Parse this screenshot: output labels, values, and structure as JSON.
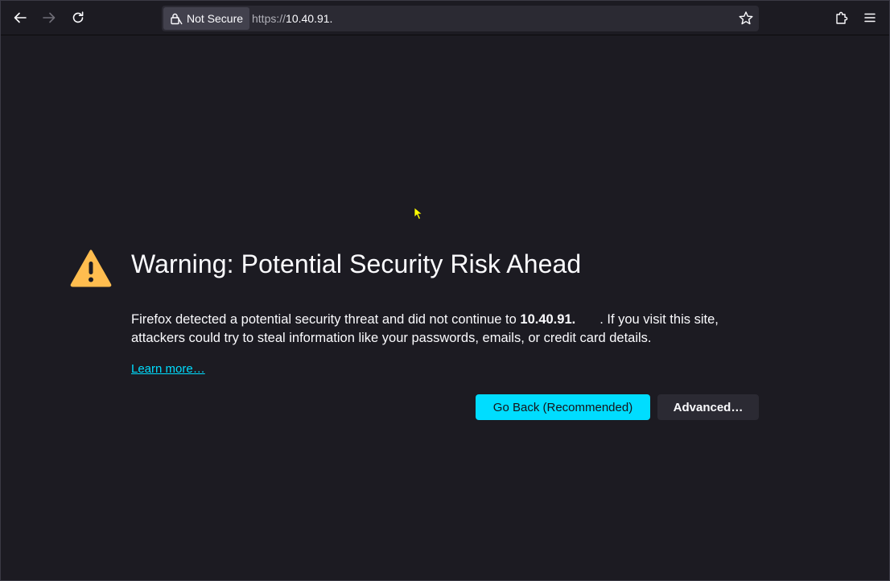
{
  "toolbar": {
    "back_icon": "arrow-left-icon",
    "forward_icon": "arrow-right-icon",
    "reload_icon": "reload-icon",
    "extensions_icon": "puzzle-icon",
    "menu_icon": "hamburger-menu-icon"
  },
  "urlbar": {
    "security_label": "Not Secure",
    "security_icon": "lock-warning-icon",
    "url_scheme": "https://",
    "url_host": "10.40.91.",
    "bookmark_icon": "star-icon"
  },
  "error_page": {
    "icon": "warning-triangle-icon",
    "title": "Warning: Potential Security Risk Ahead",
    "desc_before": "Firefox detected a potential security threat and did not continue to ",
    "desc_host": "10.40.91.",
    "desc_after": ". If you visit this site, attackers could try to steal information like your passwords, emails, or credit card details.",
    "learn_more": "Learn more…",
    "go_back_label": "Go Back (Recommended)",
    "advanced_label": "Advanced…"
  },
  "colors": {
    "background": "#1c1b22",
    "accent": "#00ddff",
    "warning": "#ffbd4f",
    "text": "#fbfbfe",
    "cursor": "#ffff00"
  }
}
